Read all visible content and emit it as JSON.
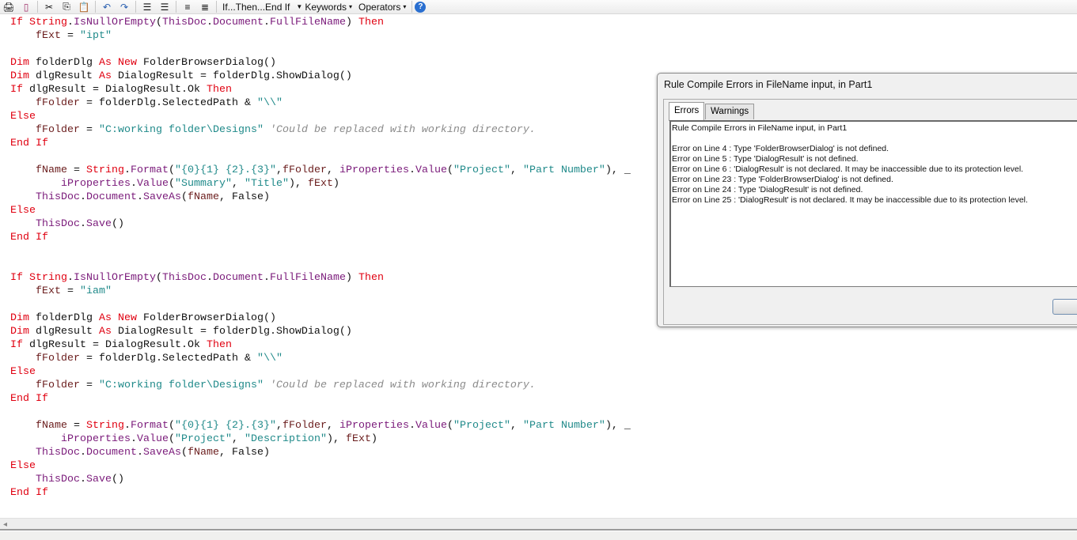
{
  "toolbar": {
    "icons": [
      "print-icon",
      "print-preview-icon",
      "cut-icon",
      "copy-icon",
      "paste-icon",
      "undo-icon",
      "redo-icon",
      "indent-icon",
      "outdent-icon",
      "comment-icon",
      "uncomment-icon"
    ],
    "if_then_label": "If...Then...End If",
    "keywords_label": "Keywords",
    "operators_label": "Operators",
    "help_icon": "help-icon"
  },
  "colors": {
    "keyword": "#e00010",
    "member": "#7a1a7a",
    "variable": "#6a1c1c",
    "string": "#208a8a",
    "comment": "#8a8a8a"
  },
  "code": [
    [
      [
        "k",
        "If "
      ],
      [
        "k",
        "String"
      ],
      [
        "o",
        "."
      ],
      [
        "p",
        "IsNullOrEmpty"
      ],
      [
        "o",
        "("
      ],
      [
        "p",
        "ThisDoc"
      ],
      [
        "o",
        "."
      ],
      [
        "p",
        "Document"
      ],
      [
        "o",
        "."
      ],
      [
        "p",
        "FullFileName"
      ],
      [
        "o",
        ") "
      ],
      [
        "k",
        "Then"
      ]
    ],
    [
      [
        "o",
        "    "
      ],
      [
        "v",
        "fExt"
      ],
      [
        "o",
        " = "
      ],
      [
        "s",
        "\"ipt\""
      ]
    ],
    [],
    [
      [
        "k",
        "Dim "
      ],
      [
        "o",
        "folderDlg "
      ],
      [
        "k",
        "As New "
      ],
      [
        "o",
        "FolderBrowserDialog()"
      ]
    ],
    [
      [
        "k",
        "Dim "
      ],
      [
        "o",
        "dlgResult "
      ],
      [
        "k",
        "As "
      ],
      [
        "o",
        "DialogResult = folderDlg.ShowDialog()"
      ]
    ],
    [
      [
        "k",
        "If "
      ],
      [
        "o",
        "dlgResult = DialogResult.Ok "
      ],
      [
        "k",
        "Then"
      ]
    ],
    [
      [
        "o",
        "    "
      ],
      [
        "v",
        "fFolder"
      ],
      [
        "o",
        " = folderDlg.SelectedPath & "
      ],
      [
        "s",
        "\"\\\\\""
      ]
    ],
    [
      [
        "k",
        "Else"
      ]
    ],
    [
      [
        "o",
        "    "
      ],
      [
        "v",
        "fFolder"
      ],
      [
        "o",
        " = "
      ],
      [
        "s",
        "\"C:working folder\\Designs\""
      ],
      [
        "o",
        " "
      ],
      [
        "c",
        "'Could be replaced with working directory."
      ]
    ],
    [
      [
        "k",
        "End If"
      ]
    ],
    [],
    [
      [
        "o",
        "    "
      ],
      [
        "v",
        "fName"
      ],
      [
        "o",
        " = "
      ],
      [
        "k",
        "String"
      ],
      [
        "o",
        "."
      ],
      [
        "p",
        "Format"
      ],
      [
        "o",
        "("
      ],
      [
        "s",
        "\"{0}{1} {2}.{3}\""
      ],
      [
        "o",
        ","
      ],
      [
        "v",
        "fFolder"
      ],
      [
        "o",
        ", "
      ],
      [
        "p",
        "iProperties"
      ],
      [
        "o",
        "."
      ],
      [
        "p",
        "Value"
      ],
      [
        "o",
        "("
      ],
      [
        "s",
        "\"Project\""
      ],
      [
        "o",
        ", "
      ],
      [
        "s",
        "\"Part Number\""
      ],
      [
        "o",
        "), _"
      ]
    ],
    [
      [
        "o",
        "        "
      ],
      [
        "p",
        "iProperties"
      ],
      [
        "o",
        "."
      ],
      [
        "p",
        "Value"
      ],
      [
        "o",
        "("
      ],
      [
        "s",
        "\"Summary\""
      ],
      [
        "o",
        ", "
      ],
      [
        "s",
        "\"Title\""
      ],
      [
        "o",
        "), "
      ],
      [
        "v",
        "fExt"
      ],
      [
        "o",
        ")"
      ]
    ],
    [
      [
        "o",
        "    "
      ],
      [
        "p",
        "ThisDoc"
      ],
      [
        "o",
        "."
      ],
      [
        "p",
        "Document"
      ],
      [
        "o",
        "."
      ],
      [
        "p",
        "SaveAs"
      ],
      [
        "o",
        "("
      ],
      [
        "v",
        "fName"
      ],
      [
        "o",
        ", False)"
      ]
    ],
    [
      [
        "k",
        "Else"
      ]
    ],
    [
      [
        "o",
        "    "
      ],
      [
        "p",
        "ThisDoc"
      ],
      [
        "o",
        "."
      ],
      [
        "p",
        "Save"
      ],
      [
        "o",
        "()"
      ]
    ],
    [
      [
        "k",
        "End If"
      ]
    ],
    [],
    [],
    [
      [
        "k",
        "If "
      ],
      [
        "k",
        "String"
      ],
      [
        "o",
        "."
      ],
      [
        "p",
        "IsNullOrEmpty"
      ],
      [
        "o",
        "("
      ],
      [
        "p",
        "ThisDoc"
      ],
      [
        "o",
        "."
      ],
      [
        "p",
        "Document"
      ],
      [
        "o",
        "."
      ],
      [
        "p",
        "FullFileName"
      ],
      [
        "o",
        ") "
      ],
      [
        "k",
        "Then"
      ]
    ],
    [
      [
        "o",
        "    "
      ],
      [
        "v",
        "fExt"
      ],
      [
        "o",
        " = "
      ],
      [
        "s",
        "\"iam\""
      ]
    ],
    [],
    [
      [
        "k",
        "Dim "
      ],
      [
        "o",
        "folderDlg "
      ],
      [
        "k",
        "As New "
      ],
      [
        "o",
        "FolderBrowserDialog()"
      ]
    ],
    [
      [
        "k",
        "Dim "
      ],
      [
        "o",
        "dlgResult "
      ],
      [
        "k",
        "As "
      ],
      [
        "o",
        "DialogResult = folderDlg.ShowDialog()"
      ]
    ],
    [
      [
        "k",
        "If "
      ],
      [
        "o",
        "dlgResult = DialogResult.Ok "
      ],
      [
        "k",
        "Then"
      ]
    ],
    [
      [
        "o",
        "    "
      ],
      [
        "v",
        "fFolder"
      ],
      [
        "o",
        " = folderDlg.SelectedPath & "
      ],
      [
        "s",
        "\"\\\\\""
      ]
    ],
    [
      [
        "k",
        "Else"
      ]
    ],
    [
      [
        "o",
        "    "
      ],
      [
        "v",
        "fFolder"
      ],
      [
        "o",
        " = "
      ],
      [
        "s",
        "\"C:working folder\\Designs\""
      ],
      [
        "o",
        " "
      ],
      [
        "c",
        "'Could be replaced with working directory."
      ]
    ],
    [
      [
        "k",
        "End If"
      ]
    ],
    [],
    [
      [
        "o",
        "    "
      ],
      [
        "v",
        "fName"
      ],
      [
        "o",
        " = "
      ],
      [
        "k",
        "String"
      ],
      [
        "o",
        "."
      ],
      [
        "p",
        "Format"
      ],
      [
        "o",
        "("
      ],
      [
        "s",
        "\"{0}{1} {2}.{3}\""
      ],
      [
        "o",
        ","
      ],
      [
        "v",
        "fFolder"
      ],
      [
        "o",
        ", "
      ],
      [
        "p",
        "iProperties"
      ],
      [
        "o",
        "."
      ],
      [
        "p",
        "Value"
      ],
      [
        "o",
        "("
      ],
      [
        "s",
        "\"Project\""
      ],
      [
        "o",
        ", "
      ],
      [
        "s",
        "\"Part Number\""
      ],
      [
        "o",
        "), _"
      ]
    ],
    [
      [
        "o",
        "        "
      ],
      [
        "p",
        "iProperties"
      ],
      [
        "o",
        "."
      ],
      [
        "p",
        "Value"
      ],
      [
        "o",
        "("
      ],
      [
        "s",
        "\"Project\""
      ],
      [
        "o",
        ", "
      ],
      [
        "s",
        "\"Description\""
      ],
      [
        "o",
        "), "
      ],
      [
        "v",
        "fExt"
      ],
      [
        "o",
        ")"
      ]
    ],
    [
      [
        "o",
        "    "
      ],
      [
        "p",
        "ThisDoc"
      ],
      [
        "o",
        "."
      ],
      [
        "p",
        "Document"
      ],
      [
        "o",
        "."
      ],
      [
        "p",
        "SaveAs"
      ],
      [
        "o",
        "("
      ],
      [
        "v",
        "fName"
      ],
      [
        "o",
        ", False)"
      ]
    ],
    [
      [
        "k",
        "Else"
      ]
    ],
    [
      [
        "o",
        "    "
      ],
      [
        "p",
        "ThisDoc"
      ],
      [
        "o",
        "."
      ],
      [
        "p",
        "Save"
      ],
      [
        "o",
        "()"
      ]
    ],
    [
      [
        "k",
        "End If"
      ]
    ]
  ],
  "dialog": {
    "title": "Rule Compile Errors in FileName input, in Part1",
    "tabs": [
      "Errors",
      "Warnings"
    ],
    "error_text": "Rule Compile Errors in FileName input, in Part1\n\nError on Line 4 : Type 'FolderBrowserDialog' is not defined.\nError on Line 5 : Type 'DialogResult' is not defined.\nError on Line 6 : 'DialogResult' is not declared. It may be inaccessible due to its protection level.\nError on Line 23 : Type 'FolderBrowserDialog' is not defined.\nError on Line 24 : Type 'DialogResult' is not defined.\nError on Line 25 : 'DialogResult' is not declared. It may be inaccessible due to its protection level."
  },
  "scrollbar": {
    "left_arrow": "◂"
  }
}
